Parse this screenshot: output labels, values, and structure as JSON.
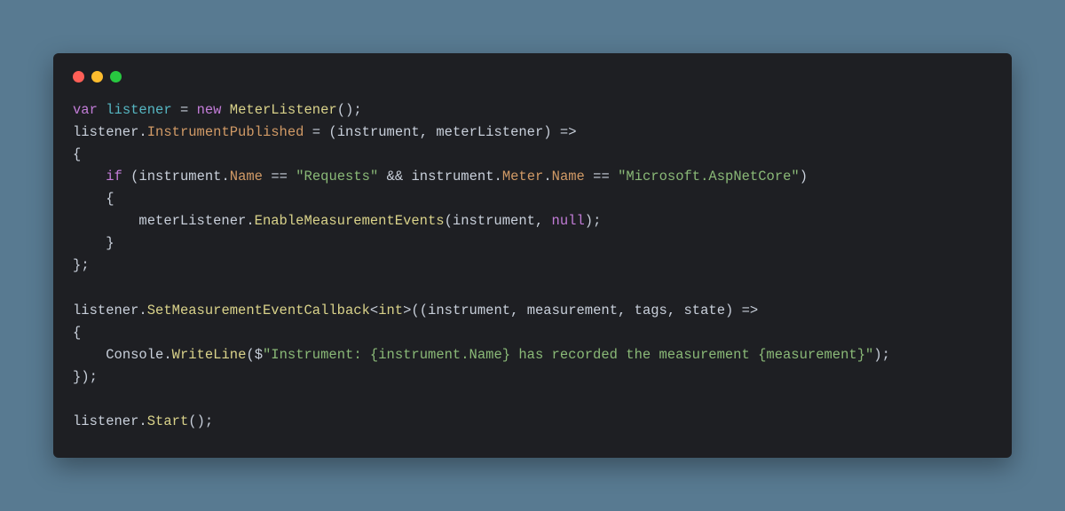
{
  "colors": {
    "page_bg": "#587a91",
    "window_bg": "#1e1f23",
    "dot_red": "#ff5f57",
    "dot_yellow": "#febc2e",
    "dot_green": "#28c840",
    "kw": "#c27cd7",
    "type": "#d9d28a",
    "string": "#8ab977",
    "prop": "#d19a66",
    "var": "#56b6c2",
    "plain": "#c8cfda"
  },
  "tokens": {
    "kw_var": "var",
    "kw_new": "new",
    "kw_if": "if",
    "id_listener": "listener",
    "ty_MeterListener": "MeterListener",
    "id_InstrumentPublished": "InstrumentPublished",
    "id_instrument": "instrument",
    "id_meterListener": "meterListener",
    "id_Name": "Name",
    "id_Meter": "Meter",
    "str_Requests": "\"Requests\"",
    "str_AspNet": "\"Microsoft.AspNetCore\"",
    "id_EnableMeasurementEvents": "EnableMeasurementEvents",
    "kw_null": "null",
    "id_SetMeasurementEventCallback": "SetMeasurementEventCallback",
    "ty_int": "int",
    "id_measurement": "measurement",
    "id_tags": "tags",
    "id_state": "state",
    "id_Console": "Console",
    "id_WriteLine": "WriteLine",
    "str_interp": "\"Instrument: {instrument.Name} has recorded the measurement {measurement}\"",
    "id_Start": "Start",
    "op_eq": "=",
    "op_deq": "==",
    "op_and": "&&",
    "op_arrow": "=>",
    "op_lt": "<",
    "op_gt": ">",
    "op_dollar": "$",
    "paren_o": "(",
    "paren_c": ")",
    "brace_o": "{",
    "brace_c": "}",
    "semi": ";",
    "comma": ",",
    "dot": "."
  }
}
